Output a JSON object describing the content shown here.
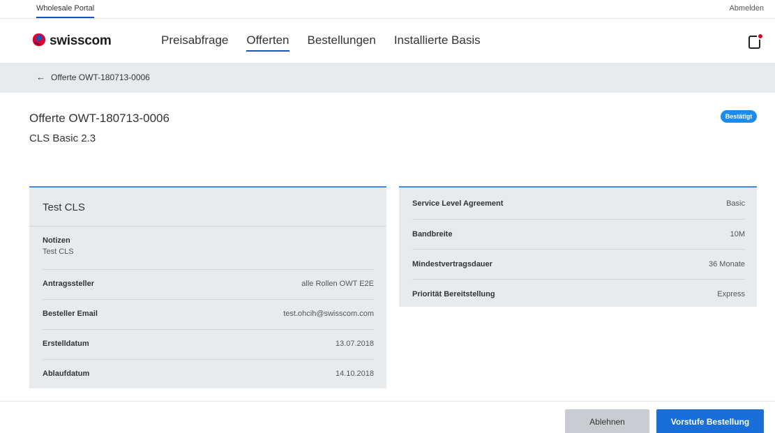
{
  "topbar": {
    "portal_label": "Wholesale Portal",
    "logout_label": "Abmelden"
  },
  "brand": {
    "name": "swisscom",
    "logo_icon": "swisscom-logo-icon"
  },
  "nav": {
    "items": [
      {
        "label": "Preisabfrage",
        "active": false
      },
      {
        "label": "Offerten",
        "active": true
      },
      {
        "label": "Bestellungen",
        "active": false
      },
      {
        "label": "Installierte Basis",
        "active": false
      }
    ],
    "notification_icon": "notification-icon"
  },
  "breadcrumb": {
    "back_icon": "arrow-left-icon",
    "label": "Offerte OWT-180713-0006"
  },
  "header": {
    "title": "Offerte OWT-180713-0006",
    "subtitle": "CLS Basic 2.3",
    "status": "Bestätigt",
    "status_color": "#1a8cf0"
  },
  "left_card": {
    "title": "Test CLS",
    "notes_label": "Notizen",
    "notes_value": "Test CLS",
    "rows": [
      {
        "label": "Antragssteller",
        "value": "alle Rollen OWT E2E"
      },
      {
        "label": "Besteller Email",
        "value": "test.ohcih@swisscom.com"
      },
      {
        "label": "Erstelldatum",
        "value": "13.07.2018"
      },
      {
        "label": "Ablaufdatum",
        "value": "14.10.2018"
      }
    ]
  },
  "right_card": {
    "rows": [
      {
        "label": "Service Level Agreement",
        "value": "Basic"
      },
      {
        "label": "Bandbreite",
        "value": "10M"
      },
      {
        "label": "Mindestvertragsdauer",
        "value": "36 Monate"
      },
      {
        "label": "Priorität Bereitstellung",
        "value": "Express"
      }
    ]
  },
  "actions": {
    "reject_label": "Ablehnen",
    "order_label": "Vorstufe Bestellung"
  },
  "colors": {
    "accent": "#1a53b8",
    "primary_button": "#1a6ed8",
    "card_bg": "#e8ebee",
    "card_border": "#3c8be2",
    "notification_dot": "#e0002a"
  }
}
